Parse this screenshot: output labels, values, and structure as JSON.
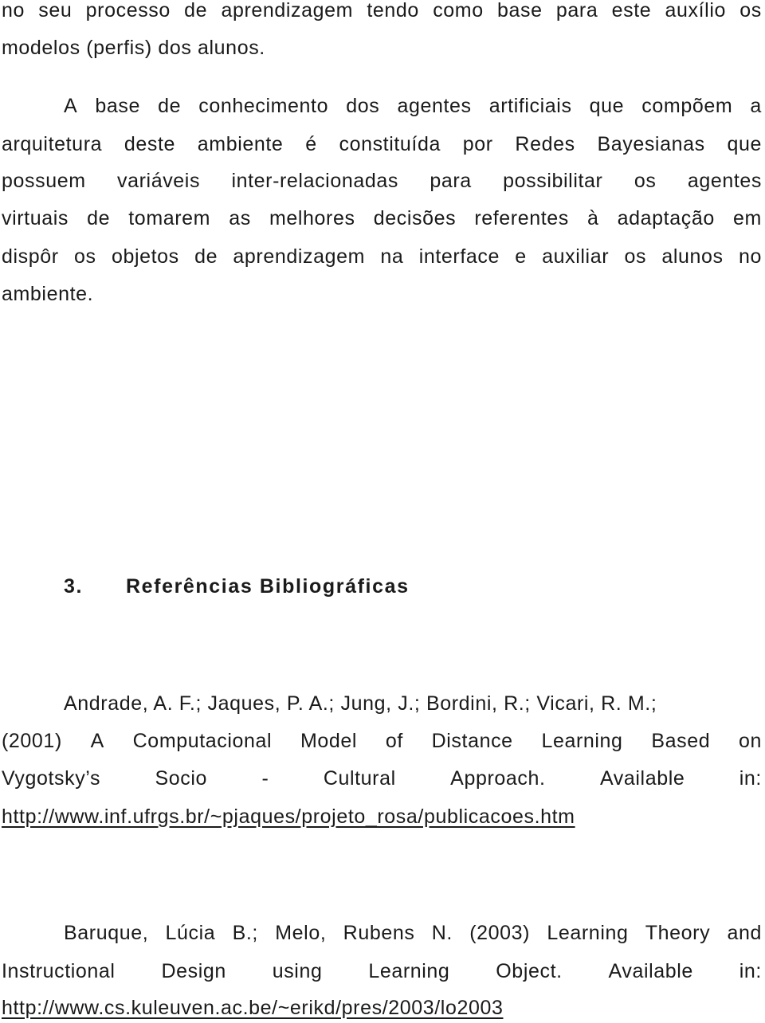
{
  "paragraph1": {
    "lines": [
      "no seu processo de aprendizagem tendo como base para este auxílio os",
      "modelos (perfis) dos alunos."
    ]
  },
  "paragraph2": {
    "lines": [
      "A base de conhecimento dos agentes artificiais que compõem a",
      "arquitetura deste ambiente é constituída por Redes Bayesianas que",
      "possuem variáveis inter-relacionadas para possibilitar os agentes",
      "virtuais de tomarem as melhores decisões referentes à adaptação em",
      "dispôr os objetos de aprendizagem na interface e auxiliar os alunos no",
      "ambiente."
    ]
  },
  "section": {
    "number": "3.",
    "title": "Referências Bibliográficas"
  },
  "references": [
    {
      "lines": [
        "Andrade, A. F.;  Jaques, P. A.;  Jung, J.; Bordini, R.; Vicari, R. M.;",
        "(2001) A Computacional Model of Distance Learning Based on",
        "Vygotsky’s Socio - Cultural Approach. Available in:"
      ],
      "url": "http://www.inf.ufrgs.br/~pjaques/projeto_rosa/publicacoes.htm"
    },
    {
      "lines": [
        "Baruque, Lúcia B.;  Melo, Rubens N. (2003) Learning Theory and",
        "Instructional Design using Learning Object. Available in:"
      ],
      "url": "http://www.cs.kuleuven.ac.be/~erikd/pres/2003/lo2003"
    }
  ]
}
